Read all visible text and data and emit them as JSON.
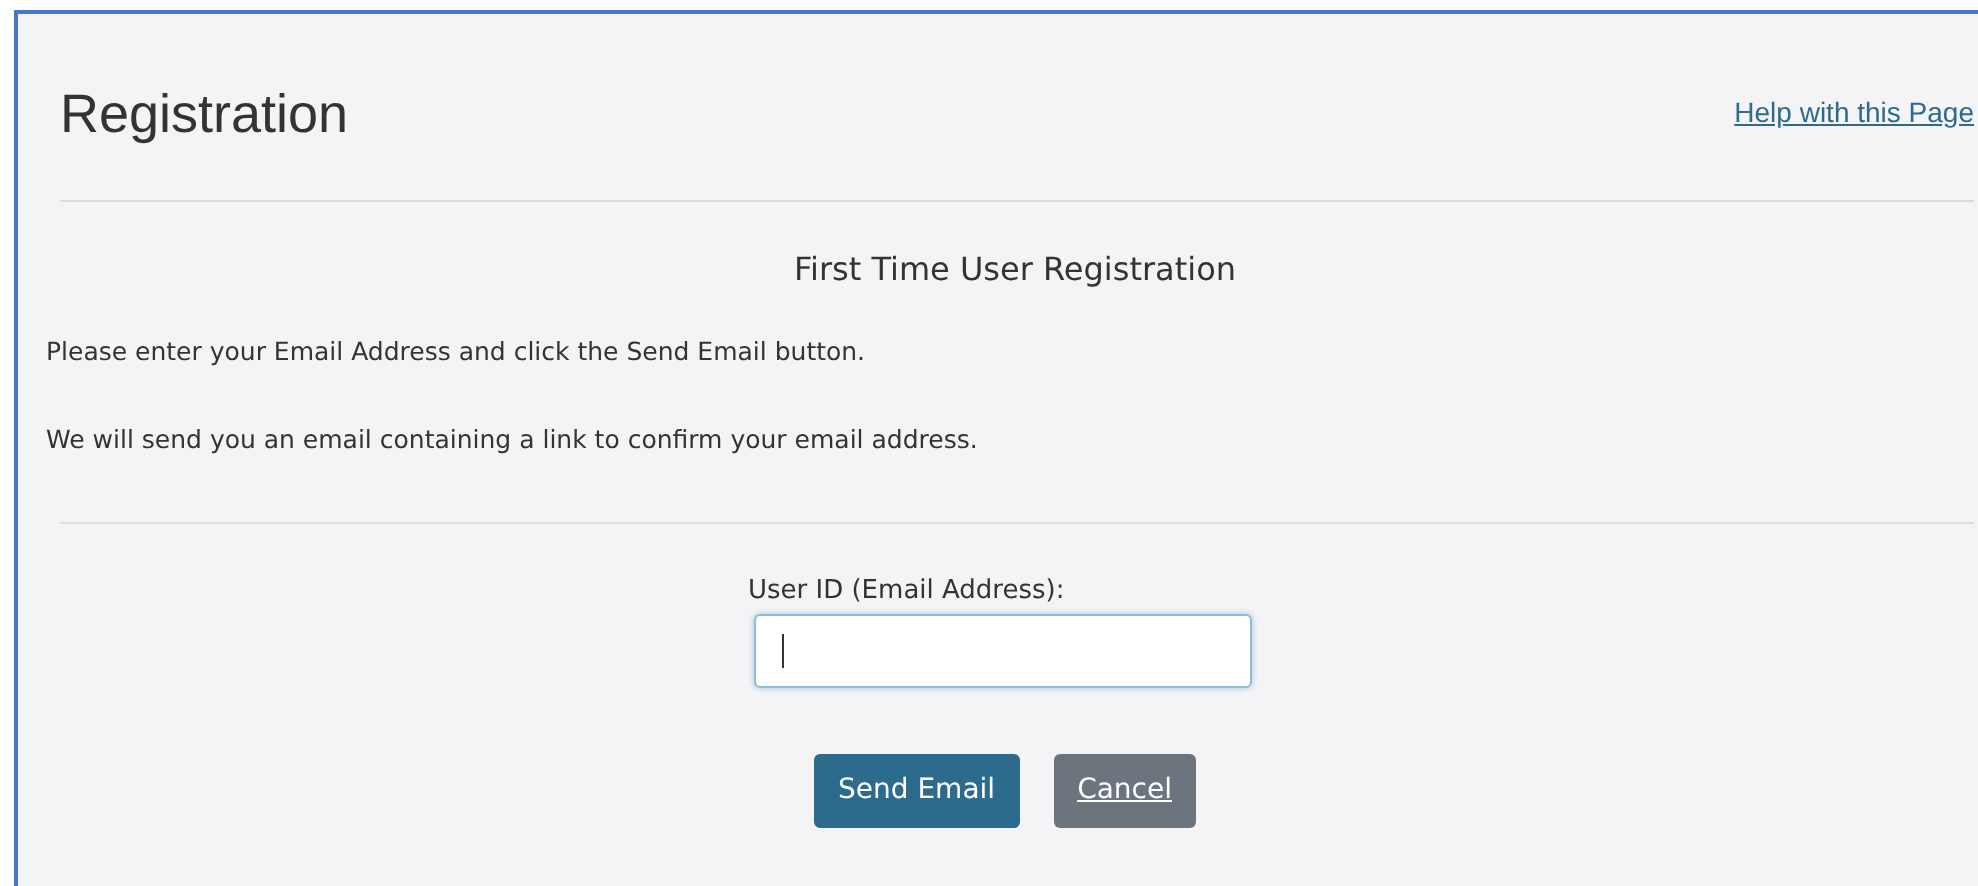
{
  "page": {
    "title": "Registration",
    "help_link": "Help with this Page"
  },
  "section": {
    "heading": "First Time User Registration",
    "paragraphs": [
      "Please enter your Email Address and click the Send Email button.",
      "We will send you an email containing a link to confirm your email address."
    ]
  },
  "form": {
    "field_label": "User ID (Email Address):",
    "focused": true
  },
  "buttons": [
    {
      "label": "Send Email",
      "kind": "primary"
    },
    {
      "label": "Cancel",
      "kind": "secondary"
    }
  ]
}
